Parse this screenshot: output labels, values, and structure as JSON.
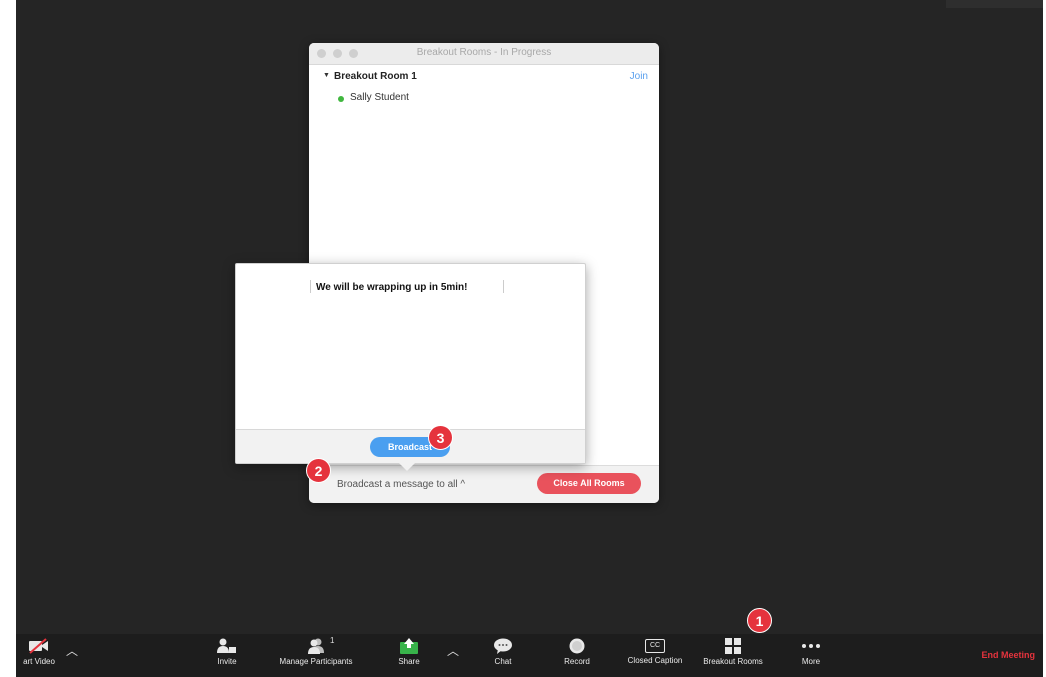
{
  "breakout_window": {
    "title": "Breakout Rooms - In Progress",
    "rooms": [
      {
        "name": "Breakout Room 1",
        "join_label": "Join",
        "participants": [
          {
            "name": "Sally Student",
            "status_color": "#40b73f"
          }
        ]
      }
    ],
    "broadcast_link": "Broadcast a message to all ^",
    "close_all_label": "Close All Rooms"
  },
  "broadcast_popup": {
    "message": "We will be wrapping up in 5min!",
    "button_label": "Broadcast"
  },
  "badges": {
    "one": "1",
    "two": "2",
    "three": "3"
  },
  "toolbar": {
    "start_video": "art Video",
    "invite": "Invite",
    "manage_participants": "Manage Participants",
    "participant_count": "1",
    "share": "Share",
    "chat": "Chat",
    "record": "Record",
    "closed_caption": "Closed Caption",
    "cc_icon_text": "CC",
    "breakout_rooms": "Breakout Rooms",
    "more": "More",
    "end_meeting": "End Meeting"
  },
  "colors": {
    "stage_bg": "#252525",
    "toolbar_bg": "#1d1d1d",
    "accent_blue": "#4a9ff0",
    "danger_red": "#e9525c",
    "badge_red": "#e5333d",
    "share_green": "#38b34a"
  }
}
